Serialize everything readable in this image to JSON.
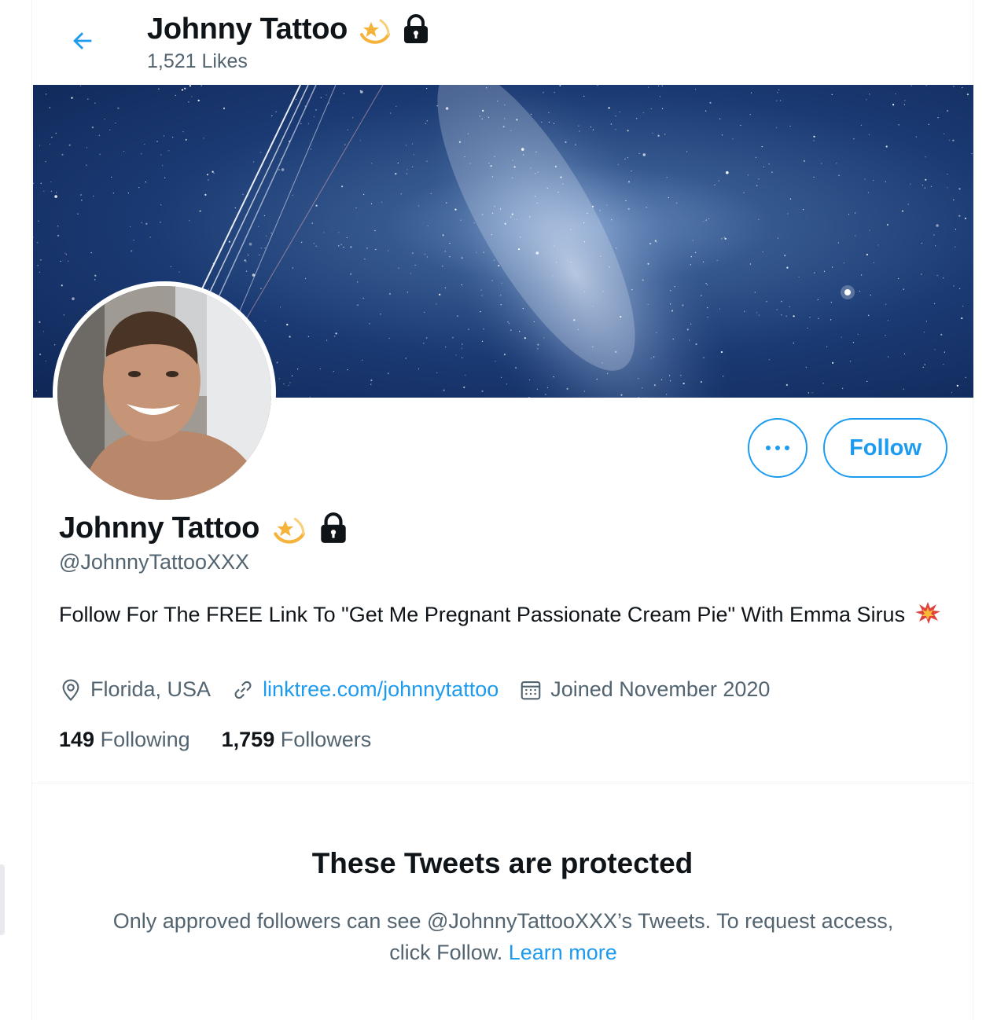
{
  "header": {
    "name": "Johnny Tattoo",
    "likes": "1,521 Likes"
  },
  "profile": {
    "name": "Johnny Tattoo",
    "handle": "@JohnnyTattooXXX",
    "bio": "Follow For The FREE Link To \"Get Me Pregnant Passionate Cream Pie\" With Emma Sirus",
    "location": "Florida, USA",
    "website": "linktree.com/johnnytattoo",
    "joined": "Joined November 2020",
    "following_count": "149",
    "following_label": "Following",
    "followers_count": "1,759",
    "followers_label": "Followers"
  },
  "actions": {
    "more_label": "•••",
    "follow_label": "Follow"
  },
  "protected": {
    "title": "These Tweets are protected",
    "body": "Only approved followers can see @JohnnyTattooXXX’s Tweets. To request access, click Follow.",
    "learn_more": "Learn more"
  },
  "icons": {
    "back": "arrow-left-icon",
    "name_badges": [
      "dizzy-star-emoji",
      "lock-icon"
    ],
    "bio_emoji": "collision-emoji",
    "location": "location-pin-icon",
    "link": "link-icon",
    "calendar": "calendar-icon"
  },
  "colors": {
    "accent": "#1d9bf0",
    "text_primary": "#0f1419",
    "text_secondary": "#536471"
  }
}
